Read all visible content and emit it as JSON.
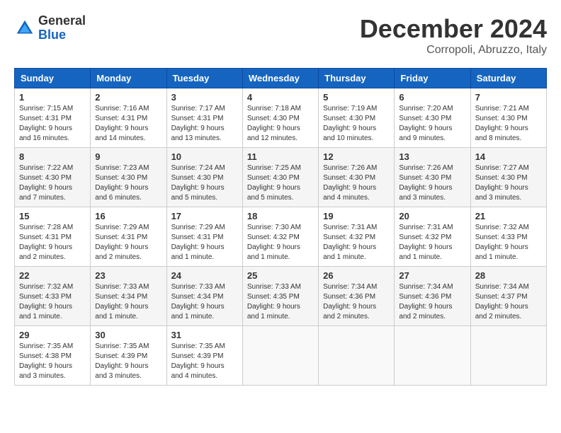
{
  "header": {
    "logo": {
      "general": "General",
      "blue": "Blue"
    },
    "title": "December 2024",
    "location": "Corropoli, Abruzzo, Italy"
  },
  "weekdays": [
    "Sunday",
    "Monday",
    "Tuesday",
    "Wednesday",
    "Thursday",
    "Friday",
    "Saturday"
  ],
  "weeks": [
    [
      {
        "day": 1,
        "sunrise": "7:15 AM",
        "sunset": "4:31 PM",
        "daylight": "9 hours and 16 minutes."
      },
      {
        "day": 2,
        "sunrise": "7:16 AM",
        "sunset": "4:31 PM",
        "daylight": "9 hours and 14 minutes."
      },
      {
        "day": 3,
        "sunrise": "7:17 AM",
        "sunset": "4:31 PM",
        "daylight": "9 hours and 13 minutes."
      },
      {
        "day": 4,
        "sunrise": "7:18 AM",
        "sunset": "4:30 PM",
        "daylight": "9 hours and 12 minutes."
      },
      {
        "day": 5,
        "sunrise": "7:19 AM",
        "sunset": "4:30 PM",
        "daylight": "9 hours and 10 minutes."
      },
      {
        "day": 6,
        "sunrise": "7:20 AM",
        "sunset": "4:30 PM",
        "daylight": "9 hours and 9 minutes."
      },
      {
        "day": 7,
        "sunrise": "7:21 AM",
        "sunset": "4:30 PM",
        "daylight": "9 hours and 8 minutes."
      }
    ],
    [
      {
        "day": 8,
        "sunrise": "7:22 AM",
        "sunset": "4:30 PM",
        "daylight": "9 hours and 7 minutes."
      },
      {
        "day": 9,
        "sunrise": "7:23 AM",
        "sunset": "4:30 PM",
        "daylight": "9 hours and 6 minutes."
      },
      {
        "day": 10,
        "sunrise": "7:24 AM",
        "sunset": "4:30 PM",
        "daylight": "9 hours and 5 minutes."
      },
      {
        "day": 11,
        "sunrise": "7:25 AM",
        "sunset": "4:30 PM",
        "daylight": "9 hours and 5 minutes."
      },
      {
        "day": 12,
        "sunrise": "7:26 AM",
        "sunset": "4:30 PM",
        "daylight": "9 hours and 4 minutes."
      },
      {
        "day": 13,
        "sunrise": "7:26 AM",
        "sunset": "4:30 PM",
        "daylight": "9 hours and 3 minutes."
      },
      {
        "day": 14,
        "sunrise": "7:27 AM",
        "sunset": "4:30 PM",
        "daylight": "9 hours and 3 minutes."
      }
    ],
    [
      {
        "day": 15,
        "sunrise": "7:28 AM",
        "sunset": "4:31 PM",
        "daylight": "9 hours and 2 minutes."
      },
      {
        "day": 16,
        "sunrise": "7:29 AM",
        "sunset": "4:31 PM",
        "daylight": "9 hours and 2 minutes."
      },
      {
        "day": 17,
        "sunrise": "7:29 AM",
        "sunset": "4:31 PM",
        "daylight": "9 hours and 1 minute."
      },
      {
        "day": 18,
        "sunrise": "7:30 AM",
        "sunset": "4:32 PM",
        "daylight": "9 hours and 1 minute."
      },
      {
        "day": 19,
        "sunrise": "7:31 AM",
        "sunset": "4:32 PM",
        "daylight": "9 hours and 1 minute."
      },
      {
        "day": 20,
        "sunrise": "7:31 AM",
        "sunset": "4:32 PM",
        "daylight": "9 hours and 1 minute."
      },
      {
        "day": 21,
        "sunrise": "7:32 AM",
        "sunset": "4:33 PM",
        "daylight": "9 hours and 1 minute."
      }
    ],
    [
      {
        "day": 22,
        "sunrise": "7:32 AM",
        "sunset": "4:33 PM",
        "daylight": "9 hours and 1 minute."
      },
      {
        "day": 23,
        "sunrise": "7:33 AM",
        "sunset": "4:34 PM",
        "daylight": "9 hours and 1 minute."
      },
      {
        "day": 24,
        "sunrise": "7:33 AM",
        "sunset": "4:34 PM",
        "daylight": "9 hours and 1 minute."
      },
      {
        "day": 25,
        "sunrise": "7:33 AM",
        "sunset": "4:35 PM",
        "daylight": "9 hours and 1 minute."
      },
      {
        "day": 26,
        "sunrise": "7:34 AM",
        "sunset": "4:36 PM",
        "daylight": "9 hours and 2 minutes."
      },
      {
        "day": 27,
        "sunrise": "7:34 AM",
        "sunset": "4:36 PM",
        "daylight": "9 hours and 2 minutes."
      },
      {
        "day": 28,
        "sunrise": "7:34 AM",
        "sunset": "4:37 PM",
        "daylight": "9 hours and 2 minutes."
      }
    ],
    [
      {
        "day": 29,
        "sunrise": "7:35 AM",
        "sunset": "4:38 PM",
        "daylight": "9 hours and 3 minutes."
      },
      {
        "day": 30,
        "sunrise": "7:35 AM",
        "sunset": "4:39 PM",
        "daylight": "9 hours and 3 minutes."
      },
      {
        "day": 31,
        "sunrise": "7:35 AM",
        "sunset": "4:39 PM",
        "daylight": "9 hours and 4 minutes."
      },
      null,
      null,
      null,
      null
    ]
  ]
}
